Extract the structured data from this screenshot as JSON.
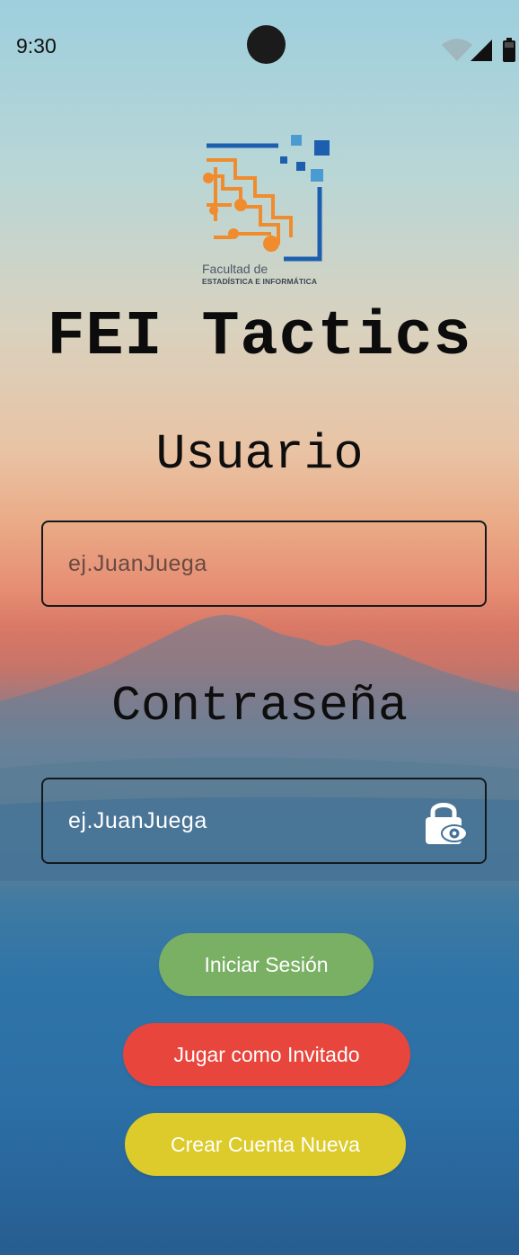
{
  "status_bar": {
    "time": "9:30",
    "icons": [
      "wifi-icon",
      "cellular-signal-icon",
      "battery-icon"
    ]
  },
  "logo": {
    "caption_line1": "Facultad de",
    "caption_line2": "ESTADÍSTICA E INFORMÁTICA",
    "colors": {
      "orange": "#f08c2e",
      "blue": "#1d5fae",
      "light_blue": "#4b9bd3"
    }
  },
  "app_title": "FEI Tactics",
  "login_form": {
    "username_label": "Usuario",
    "username_placeholder": "ej.JuanJuega",
    "password_label": "Contraseña",
    "password_placeholder": "ej.JuanJuega",
    "password_toggle_icon": "lock-eye-icon"
  },
  "buttons": {
    "login": {
      "label": "Iniciar Sesión",
      "color": "#79b063"
    },
    "guest": {
      "label": "Jugar como Invitado",
      "color": "#e8453c"
    },
    "create_account": {
      "label": "Crear Cuenta Nueva",
      "color": "#dccb2a"
    }
  }
}
